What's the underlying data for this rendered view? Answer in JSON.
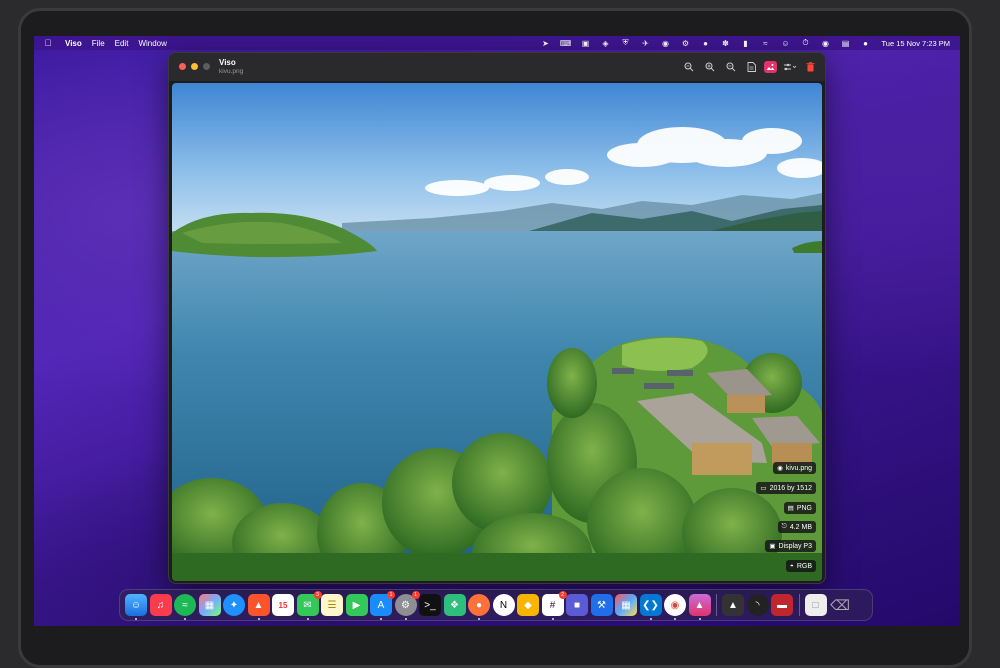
{
  "menubar": {
    "apple_icon": "apple-icon",
    "app_name": "Viso",
    "menus": [
      "File",
      "Edit",
      "Window"
    ],
    "clock": "Tue 15 Nov  7:23 PM"
  },
  "window": {
    "title": "Viso",
    "subtitle": "kivu.png",
    "toolbar": [
      "zoom-fit-icon",
      "zoom-in-icon",
      "zoom-out-icon",
      "document-icon",
      "image-edit-icon",
      "adjust-icon",
      "trash-icon"
    ]
  },
  "metadata": {
    "filename": "kivu.png",
    "dimensions": "2016 by 1512",
    "format": "PNG",
    "size": "4.2 MB",
    "color_profile": "Display P3",
    "color_model": "RGB"
  },
  "dock": {
    "apps": [
      "Finder",
      "Music",
      "Spotify",
      "Launchpad",
      "Safari",
      "Brave",
      "Calendar",
      "Messages",
      "Notes",
      "FaceTime",
      "App Store",
      "System Settings",
      "Terminal",
      "Figma",
      "Firefox",
      "Notion",
      "Sketch",
      "Slack",
      "Photo Booth",
      "Xcode",
      "Mosaic",
      "VS Code",
      "Chrome",
      "Viso",
      "Camera",
      "Arc",
      "Screens",
      "Document",
      "Trash"
    ],
    "calendar_day": "15",
    "badges": {
      "messages": "3",
      "app_store": "1",
      "system_settings": "1",
      "slack": "2"
    }
  },
  "colors": {
    "accent_pink": "#e2336b",
    "sky_top": "#4a8fd6",
    "lake": "#2b6f95"
  }
}
